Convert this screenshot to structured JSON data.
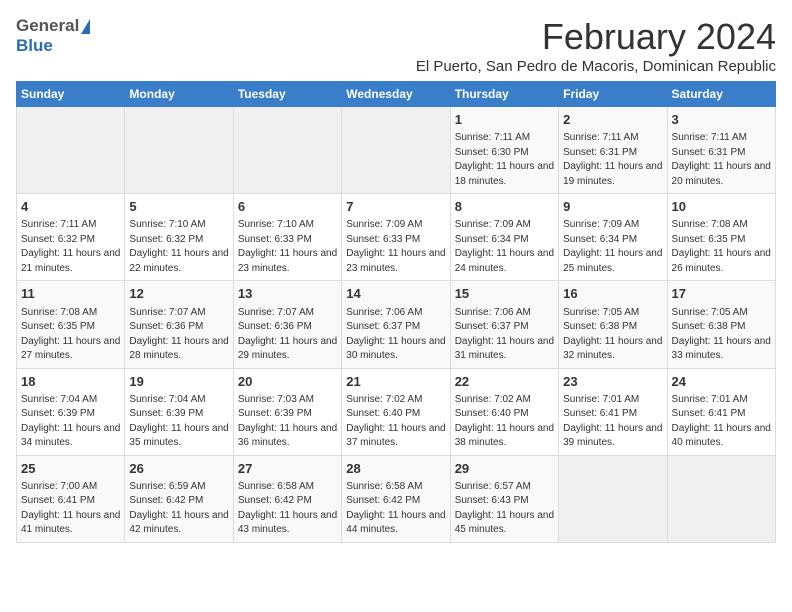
{
  "logo": {
    "general": "General",
    "blue": "Blue"
  },
  "title": {
    "month_year": "February 2024",
    "location": "El Puerto, San Pedro de Macoris, Dominican Republic"
  },
  "weekdays": [
    "Sunday",
    "Monday",
    "Tuesday",
    "Wednesday",
    "Thursday",
    "Friday",
    "Saturday"
  ],
  "weeks": [
    [
      {
        "day": "",
        "info": ""
      },
      {
        "day": "",
        "info": ""
      },
      {
        "day": "",
        "info": ""
      },
      {
        "day": "",
        "info": ""
      },
      {
        "day": "1",
        "info": "Sunrise: 7:11 AM\nSunset: 6:30 PM\nDaylight: 11 hours and 18 minutes."
      },
      {
        "day": "2",
        "info": "Sunrise: 7:11 AM\nSunset: 6:31 PM\nDaylight: 11 hours and 19 minutes."
      },
      {
        "day": "3",
        "info": "Sunrise: 7:11 AM\nSunset: 6:31 PM\nDaylight: 11 hours and 20 minutes."
      }
    ],
    [
      {
        "day": "4",
        "info": "Sunrise: 7:11 AM\nSunset: 6:32 PM\nDaylight: 11 hours and 21 minutes."
      },
      {
        "day": "5",
        "info": "Sunrise: 7:10 AM\nSunset: 6:32 PM\nDaylight: 11 hours and 22 minutes."
      },
      {
        "day": "6",
        "info": "Sunrise: 7:10 AM\nSunset: 6:33 PM\nDaylight: 11 hours and 23 minutes."
      },
      {
        "day": "7",
        "info": "Sunrise: 7:09 AM\nSunset: 6:33 PM\nDaylight: 11 hours and 23 minutes."
      },
      {
        "day": "8",
        "info": "Sunrise: 7:09 AM\nSunset: 6:34 PM\nDaylight: 11 hours and 24 minutes."
      },
      {
        "day": "9",
        "info": "Sunrise: 7:09 AM\nSunset: 6:34 PM\nDaylight: 11 hours and 25 minutes."
      },
      {
        "day": "10",
        "info": "Sunrise: 7:08 AM\nSunset: 6:35 PM\nDaylight: 11 hours and 26 minutes."
      }
    ],
    [
      {
        "day": "11",
        "info": "Sunrise: 7:08 AM\nSunset: 6:35 PM\nDaylight: 11 hours and 27 minutes."
      },
      {
        "day": "12",
        "info": "Sunrise: 7:07 AM\nSunset: 6:36 PM\nDaylight: 11 hours and 28 minutes."
      },
      {
        "day": "13",
        "info": "Sunrise: 7:07 AM\nSunset: 6:36 PM\nDaylight: 11 hours and 29 minutes."
      },
      {
        "day": "14",
        "info": "Sunrise: 7:06 AM\nSunset: 6:37 PM\nDaylight: 11 hours and 30 minutes."
      },
      {
        "day": "15",
        "info": "Sunrise: 7:06 AM\nSunset: 6:37 PM\nDaylight: 11 hours and 31 minutes."
      },
      {
        "day": "16",
        "info": "Sunrise: 7:05 AM\nSunset: 6:38 PM\nDaylight: 11 hours and 32 minutes."
      },
      {
        "day": "17",
        "info": "Sunrise: 7:05 AM\nSunset: 6:38 PM\nDaylight: 11 hours and 33 minutes."
      }
    ],
    [
      {
        "day": "18",
        "info": "Sunrise: 7:04 AM\nSunset: 6:39 PM\nDaylight: 11 hours and 34 minutes."
      },
      {
        "day": "19",
        "info": "Sunrise: 7:04 AM\nSunset: 6:39 PM\nDaylight: 11 hours and 35 minutes."
      },
      {
        "day": "20",
        "info": "Sunrise: 7:03 AM\nSunset: 6:39 PM\nDaylight: 11 hours and 36 minutes."
      },
      {
        "day": "21",
        "info": "Sunrise: 7:02 AM\nSunset: 6:40 PM\nDaylight: 11 hours and 37 minutes."
      },
      {
        "day": "22",
        "info": "Sunrise: 7:02 AM\nSunset: 6:40 PM\nDaylight: 11 hours and 38 minutes."
      },
      {
        "day": "23",
        "info": "Sunrise: 7:01 AM\nSunset: 6:41 PM\nDaylight: 11 hours and 39 minutes."
      },
      {
        "day": "24",
        "info": "Sunrise: 7:01 AM\nSunset: 6:41 PM\nDaylight: 11 hours and 40 minutes."
      }
    ],
    [
      {
        "day": "25",
        "info": "Sunrise: 7:00 AM\nSunset: 6:41 PM\nDaylight: 11 hours and 41 minutes."
      },
      {
        "day": "26",
        "info": "Sunrise: 6:59 AM\nSunset: 6:42 PM\nDaylight: 11 hours and 42 minutes."
      },
      {
        "day": "27",
        "info": "Sunrise: 6:58 AM\nSunset: 6:42 PM\nDaylight: 11 hours and 43 minutes."
      },
      {
        "day": "28",
        "info": "Sunrise: 6:58 AM\nSunset: 6:42 PM\nDaylight: 11 hours and 44 minutes."
      },
      {
        "day": "29",
        "info": "Sunrise: 6:57 AM\nSunset: 6:43 PM\nDaylight: 11 hours and 45 minutes."
      },
      {
        "day": "",
        "info": ""
      },
      {
        "day": "",
        "info": ""
      }
    ]
  ]
}
